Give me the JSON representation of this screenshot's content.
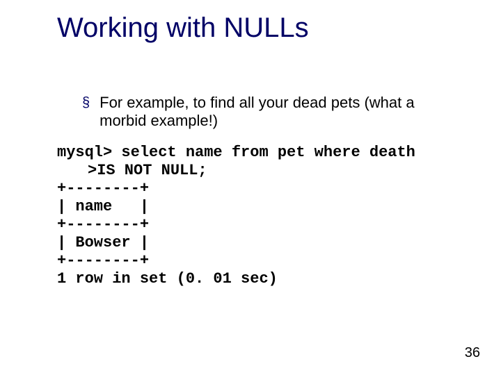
{
  "title": "Working with NULLs",
  "bullet": {
    "mark": "§",
    "text": "For example, to find all your dead pets (what a morbid example!)"
  },
  "code": {
    "l1": "mysql> select name from pet where death",
    "l1b": ">IS NOT NULL;",
    "l2": "+--------+",
    "l3": "| name   |",
    "l4": "+--------+",
    "l5": "| Bowser |",
    "l6": "+--------+",
    "l7": "1 row in set (0. 01 sec)"
  },
  "page_number": "36"
}
